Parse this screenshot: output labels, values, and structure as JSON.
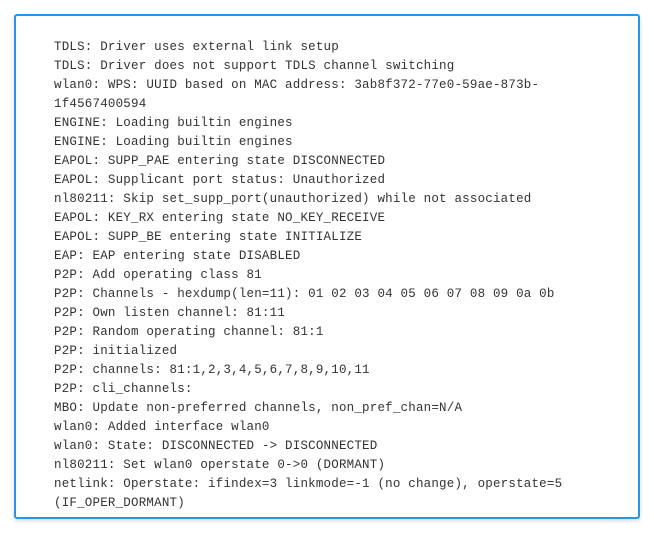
{
  "log": {
    "lines": [
      "TDLS: Driver uses external link setup",
      "TDLS: Driver does not support TDLS channel switching",
      "wlan0: WPS: UUID based on MAC address: 3ab8f372-77e0-59ae-873b-1f4567400594",
      "ENGINE: Loading builtin engines",
      "ENGINE: Loading builtin engines",
      "EAPOL: SUPP_PAE entering state DISCONNECTED",
      "EAPOL: Supplicant port status: Unauthorized",
      "nl80211: Skip set_supp_port(unauthorized) while not associated",
      "EAPOL: KEY_RX entering state NO_KEY_RECEIVE",
      "EAPOL: SUPP_BE entering state INITIALIZE",
      "EAP: EAP entering state DISABLED",
      "P2P: Add operating class 81",
      "P2P: Channels - hexdump(len=11): 01 02 03 04 05 06 07 08 09 0a 0b",
      "P2P: Own listen channel: 81:11",
      "P2P: Random operating channel: 81:1",
      "P2P: initialized",
      "P2P: channels: 81:1,2,3,4,5,6,7,8,9,10,11",
      "P2P: cli_channels:",
      "MBO: Update non-preferred channels, non_pref_chan=N/A",
      "wlan0: Added interface wlan0",
      "wlan0: State: DISCONNECTED -> DISCONNECTED",
      "nl80211: Set wlan0 operstate 0->0 (DORMANT)",
      "netlink: Operstate: ifindex=3 linkmode=-1 (no change), operstate=5 (IF_OPER_DORMANT)"
    ]
  }
}
